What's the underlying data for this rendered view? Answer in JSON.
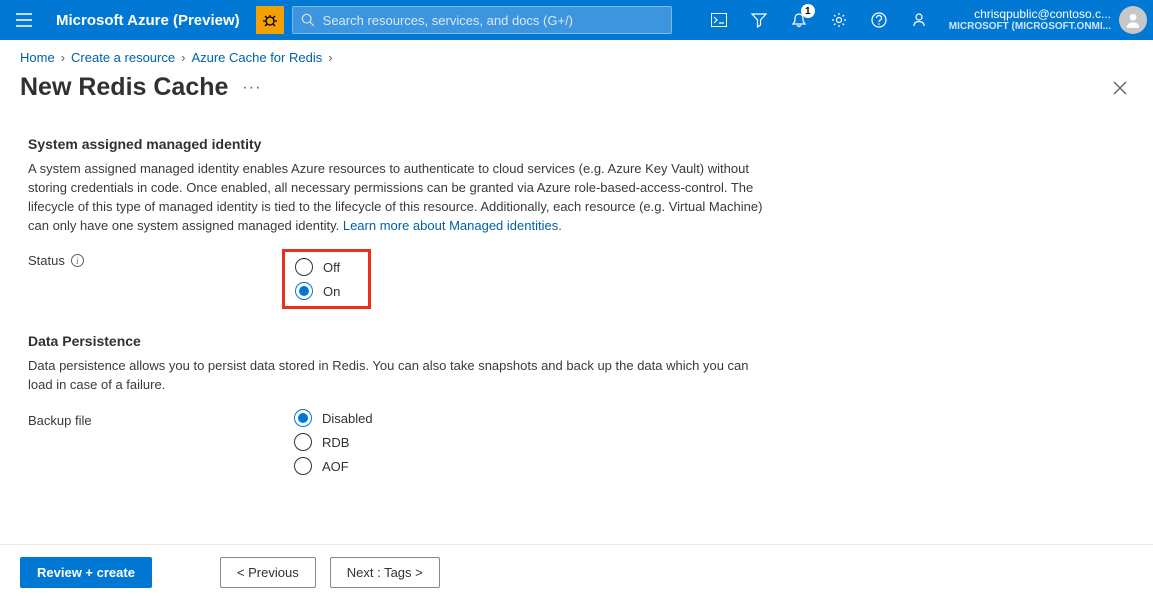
{
  "header": {
    "product": "Microsoft Azure (Preview)",
    "search_placeholder": "Search resources, services, and docs (G+/)",
    "notification_count": "1",
    "user_email": "chrisqpublic@contoso.c...",
    "user_directory": "MICROSOFT (MICROSOFT.ONMI..."
  },
  "breadcrumb": {
    "items": [
      "Home",
      "Create a resource",
      "Azure Cache for Redis"
    ]
  },
  "page": {
    "title": "New Redis Cache"
  },
  "sections": {
    "identity": {
      "heading": "System assigned managed identity",
      "description_pre": "A system assigned managed identity enables Azure resources to authenticate to cloud services (e.g. Azure Key Vault) without storing credentials in code. Once enabled, all necessary permissions can be granted via Azure role-based-access-control. The lifecycle of this type of managed identity is tied to the lifecycle of this resource. Additionally, each resource (e.g. Virtual Machine) can only have one system assigned managed identity. ",
      "description_link": "Learn more about Managed identities",
      "status_label": "Status",
      "options": {
        "off": "Off",
        "on": "On"
      },
      "selected": "on"
    },
    "persistence": {
      "heading": "Data Persistence",
      "description": "Data persistence allows you to persist data stored in Redis. You can also take snapshots and back up the data which you can load in case of a failure.",
      "backup_label": "Backup file",
      "options": {
        "disabled": "Disabled",
        "rdb": "RDB",
        "aof": "AOF"
      },
      "selected": "disabled"
    }
  },
  "footer": {
    "review": "Review + create",
    "previous": "<  Previous",
    "next": "Next : Tags  >"
  }
}
